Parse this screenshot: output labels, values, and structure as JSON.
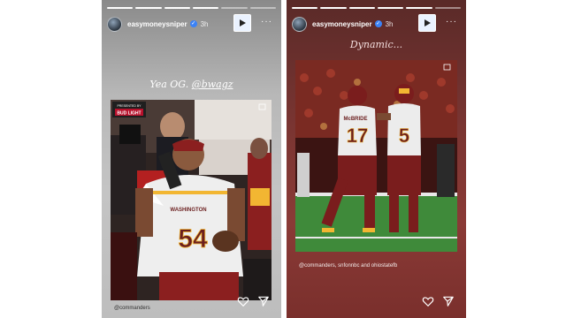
{
  "stories": [
    {
      "username": "easymoneysniper",
      "time": "3h",
      "caption_text": "Yea OG. ",
      "caption_mention": "@bwagz",
      "sponsor_top": "PRESENTED BY",
      "sponsor_brand": "BUD LIGHT",
      "photo_credit": "@commanders",
      "jersey_team": "WASHINGTON",
      "jersey_number": "54",
      "progress_done": 4,
      "progress_total": 6
    },
    {
      "username": "easymoneysniper",
      "time": "3h",
      "caption_text": "Dynamic...",
      "photo_credit": "@commanders, snfonnbc and ohiostatefb",
      "jersey_a_name": "McBRIDE",
      "jersey_a_number": "17",
      "jersey_b_number": "5",
      "progress_done": 5,
      "progress_total": 6
    }
  ],
  "colors": {
    "burgundy": "#6b1f1f",
    "gold": "#f2b632",
    "verified": "#3b82f6"
  }
}
